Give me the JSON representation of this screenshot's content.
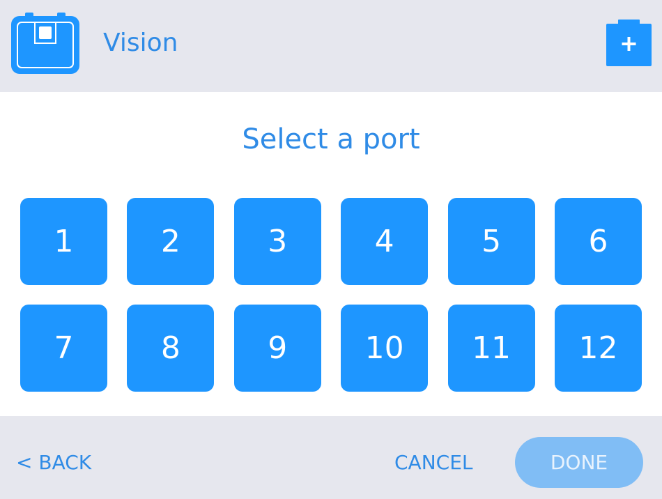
{
  "header": {
    "device_icon": "vision-sensor-icon",
    "title": "Vision",
    "add_icon": "plus-icon",
    "add_label": "+"
  },
  "main": {
    "heading": "Select a port",
    "ports": [
      "1",
      "2",
      "3",
      "4",
      "5",
      "6",
      "7",
      "8",
      "9",
      "10",
      "11",
      "12"
    ]
  },
  "footer": {
    "back_label": "< BACK",
    "cancel_label": "CANCEL",
    "done_label": "DONE",
    "done_enabled": false
  },
  "colors": {
    "accent": "#1e96ff",
    "text_accent": "#2f8be6",
    "bar_background": "#e6e7ee",
    "done_disabled": "#80bdf5"
  }
}
